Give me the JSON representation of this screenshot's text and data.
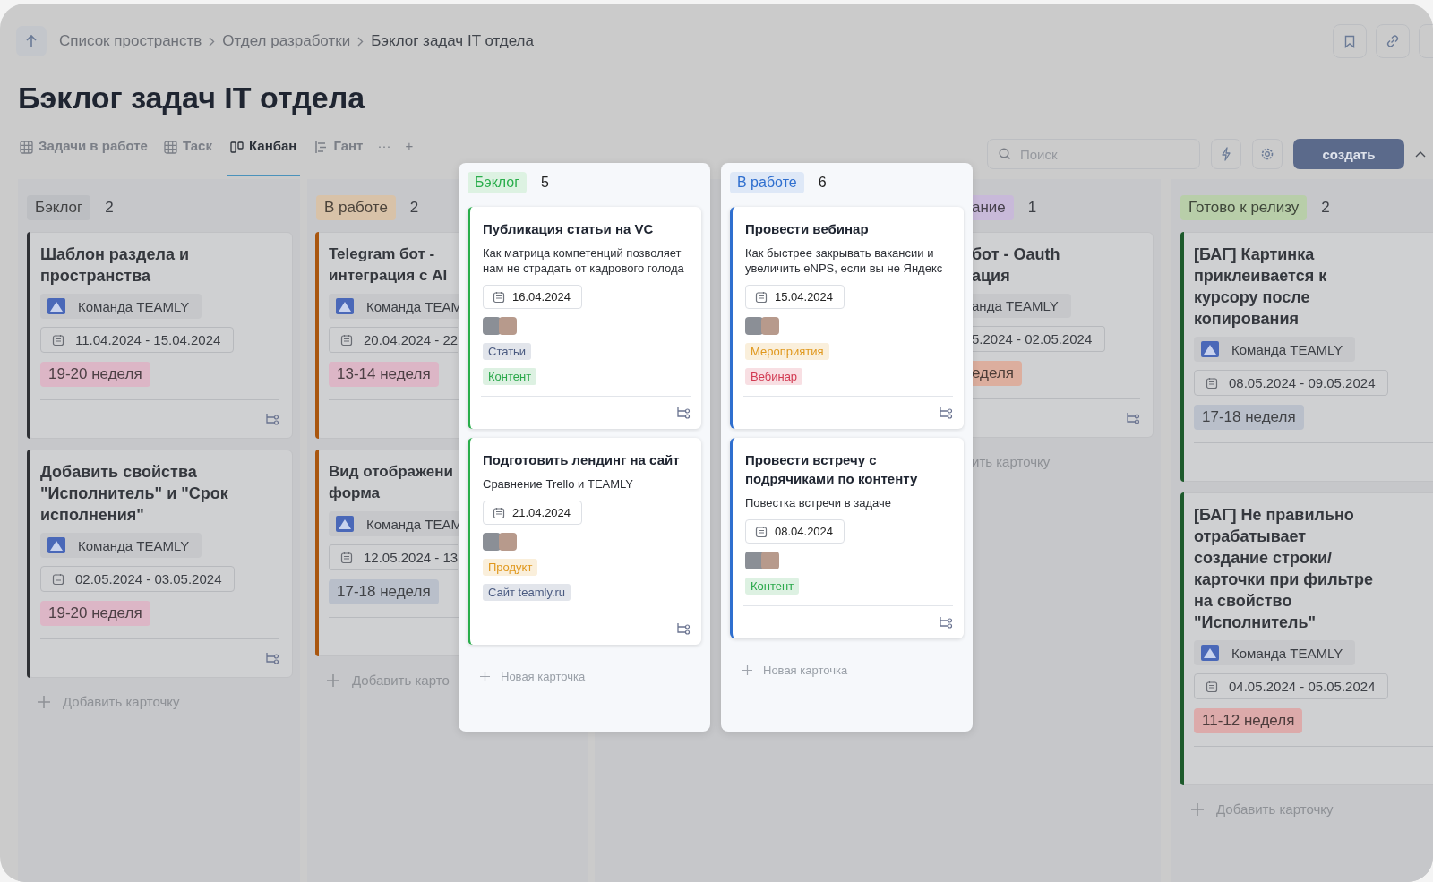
{
  "breadcrumb": [
    "Список пространств",
    "Отдел разработки",
    "Бэклог задач IT отдела"
  ],
  "title": "Бэклог задач IT отдела",
  "tabs": [
    {
      "label": "Задачи в работе",
      "kind": "table",
      "selected": false
    },
    {
      "label": "Таск",
      "kind": "table",
      "selected": false
    },
    {
      "label": "Канбан",
      "kind": "board",
      "selected": true
    },
    {
      "label": "Гант",
      "kind": "gantt",
      "selected": false
    }
  ],
  "tabs_more": "···",
  "tabs_add": "+",
  "search": {
    "placeholder": "Поиск"
  },
  "create_button": "создать",
  "columns": [
    {
      "kind": "full",
      "label": "Бэклог",
      "color": "#bcbec2",
      "count": "2",
      "accent": {
        "color": "#2e3035"
      },
      "add_label": "Добавить карточку",
      "cards": [
        {
          "title": "Шаблон раздела и пространства",
          "team": "Команда TEAMLY",
          "dates": "11.04.2024 - 15.04.2024",
          "week": {
            "label": "19-20 неделя",
            "color": "#dcb6c6"
          },
          "has_subtasks": true
        },
        {
          "title": "Добавить свойства \"Исполнитель\" и \"Срок исполнения\"",
          "team": "Команда TEAMLY",
          "dates": "02.05.2024 - 03.05.2024",
          "week": {
            "label": "19-20 неделя",
            "color": "#dcb6c6"
          },
          "has_subtasks": true
        }
      ]
    },
    {
      "kind": "cut_right",
      "label": "В работе",
      "color": "#d8c2a8",
      "count": "2",
      "accent": {
        "color": "#a9560f"
      },
      "add_label": "Добавить карто",
      "cards": [
        {
          "title": "Telegram бот - интеграция с AI",
          "team": "Команда TEAM",
          "dates": "20.04.2024 - 22",
          "week": {
            "label": "13-14 неделя",
            "color": "#dcb6c6"
          },
          "has_subtasks": false
        },
        {
          "title": "Вид отображени форма",
          "team": "Команда TEAM",
          "dates": "12.05.2024 - 13",
          "week": {
            "label": "17-18 неделя",
            "color": "#b9bfca"
          },
          "has_subtasks": false
        }
      ]
    },
    {
      "kind": "cut_left",
      "label": "ание",
      "color": "#c8b9d9",
      "count": "1",
      "add_label": "ить карточку",
      "cards": [
        {
          "title": "бот - Oauth ация",
          "team": "анда TEAMLY",
          "dates": "5.2024 - 02.05.2024",
          "week": {
            "label": "еделя",
            "color": "#dcae9e"
          },
          "has_subtasks": true
        }
      ]
    },
    {
      "kind": "full",
      "label": "Готово к релизу",
      "color": "#b8cea9",
      "count": "2",
      "accent": {
        "color": "#1d5a2c"
      },
      "add_label": "Добавить карточку",
      "cards": [
        {
          "title": "[БАГ] Картинка приклеивается к курсору после копирования",
          "team": "Команда TEAMLY",
          "dates": "08.05.2024 - 09.05.2024",
          "week": {
            "label": "17-18 неделя",
            "color": "#b9bfca"
          }
        },
        {
          "title": "[БАГ] Не правильно отрабатывает создание строки/карточки при фильтре на свойство \"Исполнитель\"",
          "team": "Команда TEAMLY",
          "dates": "04.05.2024 - 05.05.2024",
          "week": {
            "label": "11-12 неделя",
            "color": "#dcaaaa"
          }
        }
      ]
    }
  ],
  "panels": [
    {
      "label": "Бэклог",
      "color": "#2aae4c",
      "count": "5",
      "add_label": "Новая карточка",
      "cards": [
        {
          "title": "Публикация статьи на VC",
          "description": "Как матрица компетенций позволяет нам не страдать от кадрового голода",
          "date": "16.04.2024",
          "tags": [
            {
              "label": "Статьи",
              "color": "#4a5a80"
            },
            {
              "label": "Контент",
              "color": "#2aa84a"
            }
          ]
        },
        {
          "title": "Подготовить лендинг на сайт",
          "description": "Сравнение Trello и TEAMLY",
          "date": "21.04.2024",
          "tags": [
            {
              "label": "Продукт",
              "color": "#e0981e"
            },
            {
              "label": "Сайт teamly.ru",
              "color": "#4a5a80"
            }
          ]
        }
      ]
    },
    {
      "label": "В работе",
      "color": "#2f6fcf",
      "count": "6",
      "add_label": "Новая карточка",
      "cards": [
        {
          "title": "Провести вебинар",
          "description": "Как быстрее закрывать вакансии и увеличить eNPS, если вы не Яндекс",
          "date": "15.04.2024",
          "tags": [
            {
              "label": "Мероприятия",
              "color": "#e0981e"
            },
            {
              "label": "Вебинар",
              "color": "#d23a52"
            }
          ]
        },
        {
          "title": "Провести встречу с подрячиками по контенту",
          "description": "Повестка встречи в задаче",
          "date": "08.04.2024",
          "tags": [
            {
              "label": "Контент",
              "color": "#2aa84a"
            }
          ]
        }
      ]
    }
  ]
}
